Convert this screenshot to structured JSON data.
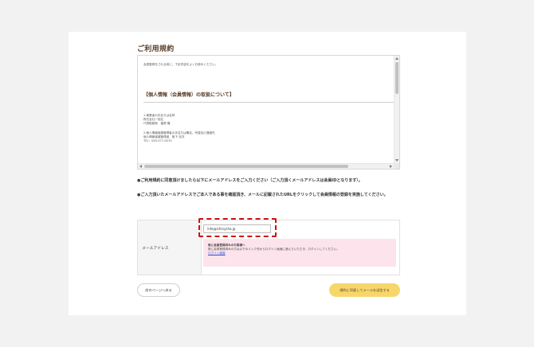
{
  "page": {
    "title": "ご利用規約"
  },
  "terms": {
    "intro": "会員登録をされる前に、下記内容をよくお読みください。",
    "heading": "【個人情報（会員情報）の取扱について】",
    "block1": [
      "1.事業者の氏名又は名称",
      "株式会社一信社",
      "代表取締役　裏原 隆"
    ],
    "block2": [
      "2.個人情報保護管理者の氏名又は職名、所属及び連絡先",
      "個人情報保護管理者　阪下 忠次",
      "TEL：045-577-0070"
    ]
  },
  "notes": {
    "bullet": "●",
    "note1": "ご利用規約に同意頂けましたら以下にメールアドレスをご入力ください（ご入力頂くメールアドレスは会員IDとなります）。",
    "note2": "ご入力頂いたメールアドレスでご本人である事を確認頂き、メールに記載されたURLをクリックして会員情報の登録を実施してください。"
  },
  "form": {
    "email_label": "メールアドレス",
    "email_value": "info@ichinysha.jp",
    "notice_title": "既に会員登録済みのお客様へ",
    "notice_text": "既に会員登録済みの方は以下のリンク先からログイン画面に進んでいただき、ログインしてください。",
    "notice_link": "ログイン画面"
  },
  "buttons": {
    "back": "前のページへ戻る",
    "submit": "規約に同意してメールを送信する"
  },
  "colors": {
    "accent_brown": "#5a3e28",
    "submit_yellow": "#f7d76b",
    "notice_pink": "#fde4ec",
    "highlight_red": "#cc1111"
  }
}
